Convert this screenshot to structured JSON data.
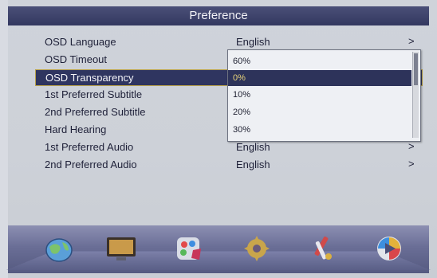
{
  "title": "Preference",
  "menu": {
    "items": [
      {
        "label": "OSD Language",
        "value": "English",
        "arrow": ">"
      },
      {
        "label": "OSD Timeout",
        "value": "",
        "arrow": ""
      },
      {
        "label": "OSD Transparency",
        "value": "",
        "arrow": ""
      },
      {
        "label": "1st Preferred Subtitle",
        "value": "",
        "arrow": ""
      },
      {
        "label": "2nd Preferred Subtitle",
        "value": "",
        "arrow": ""
      },
      {
        "label": "Hard Hearing",
        "value": "",
        "arrow": ""
      },
      {
        "label": "1st Preferred Audio",
        "value": "English",
        "arrow": ">"
      },
      {
        "label": "2nd Preferred Audio",
        "value": "English",
        "arrow": ">"
      }
    ]
  },
  "dropdown": {
    "options": [
      "60%",
      "0%",
      "10%",
      "20%",
      "30%"
    ],
    "selected": "0%"
  },
  "dock": {
    "icons": [
      "globe-icon",
      "monitor-icon",
      "palette-icon",
      "gear-icon",
      "tools-icon",
      "media-play-icon"
    ]
  },
  "colors": {
    "title_bar": "#3a3f6a",
    "selection": "#2f3560",
    "highlight_text": "#e8d37a"
  }
}
